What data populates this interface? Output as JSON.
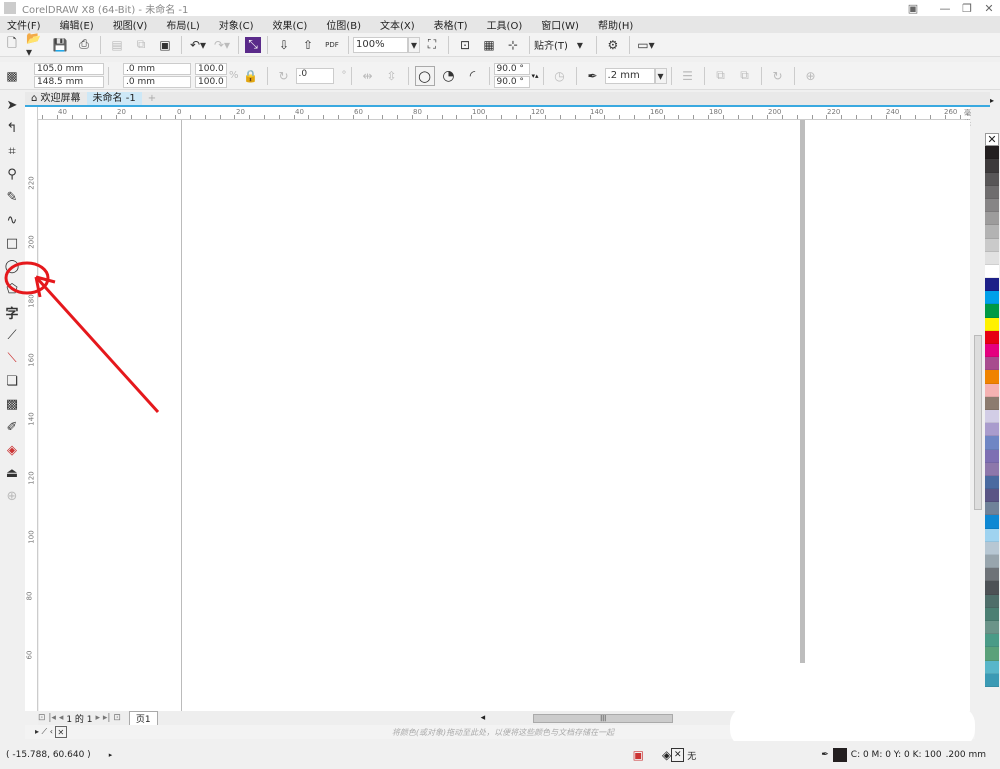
{
  "title": "CorelDRAW X8 (64-Bit) - 未命名 -1",
  "menu": [
    "文件(F)",
    "编辑(E)",
    "视图(V)",
    "布局(L)",
    "对象(C)",
    "效果(C)",
    "位图(B)",
    "文本(X)",
    "表格(T)",
    "工具(O)",
    "窗口(W)",
    "帮助(H)"
  ],
  "toolbar": {
    "zoom": "100%",
    "snap": "贴齐(T)",
    "pdf": "PDF"
  },
  "props": {
    "x": "105.0 mm",
    "y": "148.5 mm",
    "w": ".0 mm",
    "h": ".0 mm",
    "sx": "100.0",
    "sy": "100.0",
    "pct": "%",
    "rot": ".0",
    "deg": "°",
    "start_angle": "90.0 °",
    "end_angle": "90.0 °",
    "outline": ".2 mm"
  },
  "tabs": {
    "welcome": "欢迎屏幕",
    "doc": "未命名 -1",
    "add": "+"
  },
  "ruler": {
    "units": "毫米",
    "h_labels": [
      "40",
      "20",
      "0",
      "20",
      "40",
      "60",
      "80",
      "100",
      "120",
      "140",
      "160",
      "180",
      "200",
      "220",
      "240",
      "260"
    ],
    "v_labels": [
      "220",
      "200",
      "180",
      "160",
      "140",
      "120",
      "100",
      "80",
      "60"
    ]
  },
  "pagenav": {
    "count": "1 的 1",
    "page": "页1"
  },
  "dropbar": {
    "hint": "将颜色(或对象)拖动至此处，以便将这些颜色与文档存储在一起"
  },
  "status": {
    "coords": "( -15.788, 60.640 )",
    "fill": "无",
    "outline_color": "C: 0 M: 0 Y: 0 K: 100",
    "outline_width": ".200 mm"
  },
  "palette": [
    "#231f20",
    "#3d3a3b",
    "#585657",
    "#6f6d6e",
    "#878586",
    "#9d9c9c",
    "#b3b3b3",
    "#cacaca",
    "#e1e1e1",
    "#ffffff",
    "#1d2088",
    "#00a0e9",
    "#009944",
    "#fff100",
    "#e60012",
    "#e4007f",
    "#a84c8e",
    "#f08300",
    "#f5b2b2",
    "#8c7b6f",
    "#d2cde6",
    "#a99ccd",
    "#6f86c4",
    "#7e6fb3",
    "#8d77ab",
    "#4a6aa0",
    "#5a5585",
    "#6f8299",
    "#0e88d3",
    "#9fd3f0",
    "#b7c7d3",
    "#98a5ad",
    "#6e7378",
    "#4d5256",
    "#4e6e6a",
    "#4b7f73",
    "#6b9489",
    "#4a9b87",
    "#5aa17a",
    "#58b6c9",
    "#3b9ab4"
  ],
  "accent": "#39a9e0"
}
